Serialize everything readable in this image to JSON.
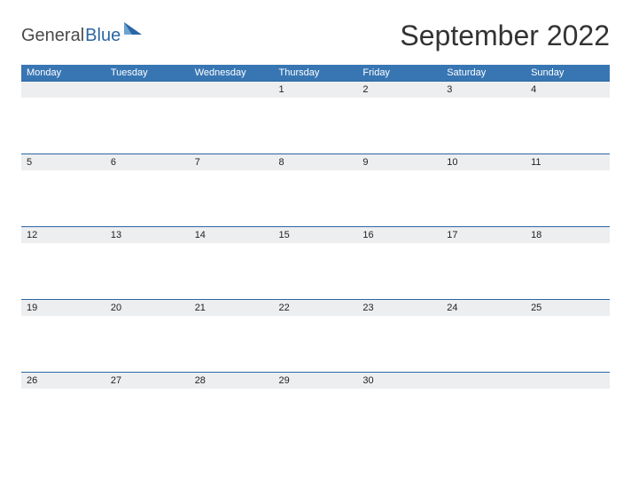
{
  "brand": {
    "part1": "General",
    "part2": "Blue"
  },
  "title": "September 2022",
  "colors": {
    "accent": "#3876b3",
    "rule": "#2b66a4",
    "shade": "#edeef0"
  },
  "days": [
    "Monday",
    "Tuesday",
    "Wednesday",
    "Thursday",
    "Friday",
    "Saturday",
    "Sunday"
  ],
  "weeks": [
    [
      "",
      "",
      "",
      "1",
      "2",
      "3",
      "4"
    ],
    [
      "5",
      "6",
      "7",
      "8",
      "9",
      "10",
      "11"
    ],
    [
      "12",
      "13",
      "14",
      "15",
      "16",
      "17",
      "18"
    ],
    [
      "19",
      "20",
      "21",
      "22",
      "23",
      "24",
      "25"
    ],
    [
      "26",
      "27",
      "28",
      "29",
      "30",
      "",
      ""
    ]
  ]
}
